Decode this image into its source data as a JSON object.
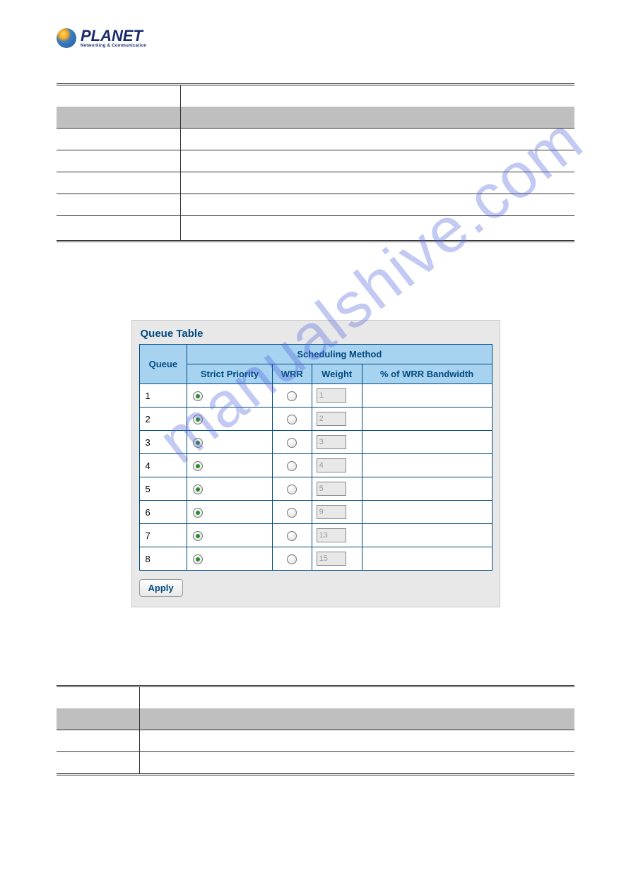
{
  "logo": {
    "main": "PLANET",
    "sub": "Networking & Communication"
  },
  "watermark": "manualshive.com",
  "queue_table": {
    "title": "Queue Table",
    "headers": {
      "queue": "Queue",
      "scheduling": "Scheduling Method",
      "sp": "Strict Priority",
      "wrr": "WRR",
      "weight": "Weight",
      "bw": "% of WRR Bandwidth"
    },
    "rows": [
      {
        "queue": "1",
        "sp": true,
        "wrr": false,
        "weight": "1",
        "bw": ""
      },
      {
        "queue": "2",
        "sp": true,
        "wrr": false,
        "weight": "2",
        "bw": ""
      },
      {
        "queue": "3",
        "sp": true,
        "wrr": false,
        "weight": "3",
        "bw": ""
      },
      {
        "queue": "4",
        "sp": true,
        "wrr": false,
        "weight": "4",
        "bw": ""
      },
      {
        "queue": "5",
        "sp": true,
        "wrr": false,
        "weight": "5",
        "bw": ""
      },
      {
        "queue": "6",
        "sp": true,
        "wrr": false,
        "weight": "9",
        "bw": ""
      },
      {
        "queue": "7",
        "sp": true,
        "wrr": false,
        "weight": "13",
        "bw": ""
      },
      {
        "queue": "8",
        "sp": true,
        "wrr": false,
        "weight": "15",
        "bw": ""
      }
    ],
    "apply": "Apply"
  }
}
